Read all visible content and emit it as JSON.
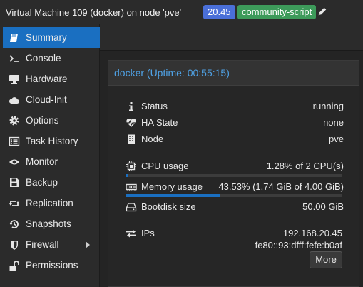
{
  "header": {
    "title": "Virtual Machine 109 (docker) on node 'pve'",
    "tags": [
      "20.45",
      "community-script"
    ]
  },
  "sidebar": {
    "items": [
      {
        "label": "Summary",
        "icon": "book-icon",
        "active": true
      },
      {
        "label": "Console",
        "icon": "terminal-icon"
      },
      {
        "label": "Hardware",
        "icon": "desktop-icon"
      },
      {
        "label": "Cloud-Init",
        "icon": "cloud-icon"
      },
      {
        "label": "Options",
        "icon": "gear-icon"
      },
      {
        "label": "Task History",
        "icon": "list-icon"
      },
      {
        "label": "Monitor",
        "icon": "eye-icon"
      },
      {
        "label": "Backup",
        "icon": "floppy-icon"
      },
      {
        "label": "Replication",
        "icon": "retweet-icon"
      },
      {
        "label": "Snapshots",
        "icon": "history-icon"
      },
      {
        "label": "Firewall",
        "icon": "shield-icon",
        "has_submenu": true
      },
      {
        "label": "Permissions",
        "icon": "unlock-icon"
      }
    ]
  },
  "panel": {
    "title": "docker (Uptime: 00:55:15)",
    "status": {
      "label": "Status",
      "value": "running"
    },
    "ha_state": {
      "label": "HA State",
      "value": "none"
    },
    "node": {
      "label": "Node",
      "value": "pve"
    },
    "cpu": {
      "label": "CPU usage",
      "value": "1.28% of 2 CPU(s)",
      "fraction": 0.0128
    },
    "memory": {
      "label": "Memory usage",
      "value": "43.53% (1.74 GiB of 4.00 GiB)",
      "fraction": 0.4353
    },
    "bootdisk": {
      "label": "Bootdisk size",
      "value": "50.00 GiB"
    },
    "ips": {
      "label": "IPs",
      "values": [
        "192.168.20.45",
        "fe80::93:dfff:fefe:b0af"
      ],
      "more_label": "More"
    }
  },
  "colors": {
    "accent": "#1a6fc1",
    "title_blue": "#4fa2e6",
    "tag_blue": "#4a6fd8",
    "tag_green": "#3d9a5a"
  }
}
